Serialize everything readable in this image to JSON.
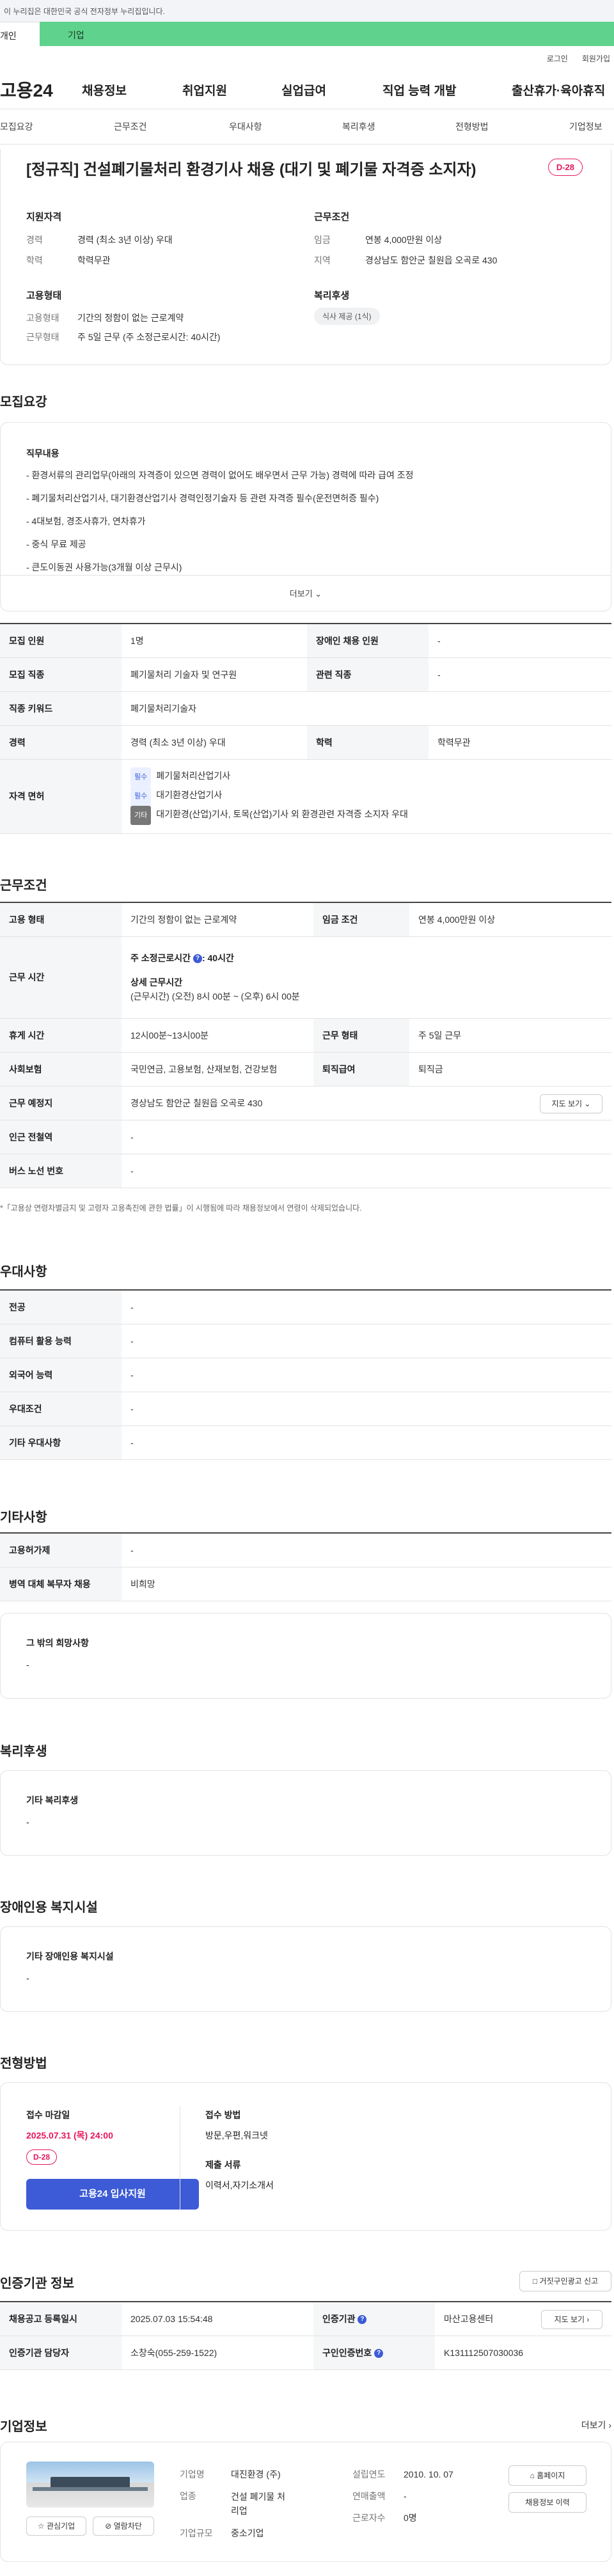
{
  "topbar": {
    "notice": "이 누리집은 대한민국 공식 전자정부 누리집입니다."
  },
  "tabs": {
    "individual": "개인",
    "company": "기업"
  },
  "utility": {
    "login": "로그인",
    "join": "회원가입"
  },
  "gnb": {
    "logo": "고용24",
    "items": [
      "채용정보",
      "취업지원",
      "실업급여",
      "직업 능력 개발",
      "출산휴가·육아휴직"
    ]
  },
  "anchors": [
    "모집요강",
    "근무조건",
    "우대사항",
    "복리후생",
    "전형방법",
    "기업정보"
  ],
  "job": {
    "title": "[정규직] 건설폐기물처리 환경기사 채용 (대기 및 폐기물 자격증 소지자)",
    "dday": "D-28",
    "qual_title": "지원자격",
    "career_k": "경력",
    "career_v": "경력 (최소 3년 이상) 우대",
    "edu_k": "학력",
    "edu_v": "학력무관",
    "emp_title": "고용형태",
    "emptype_k": "고용형태",
    "emptype_v": "기간의 정함이 없는 근로계약",
    "worktype_k": "근무형태",
    "worktype_v": "주 5일 근무 (주 소정근로시간: 40시간)",
    "cond_title": "근무조건",
    "wage_k": "임금",
    "wage_v": "연봉 4,000만원 이상",
    "region_k": "지역",
    "region_v": "경상남도 함안군 칠원읍 오곡로 430",
    "welfare_title": "복리후생",
    "welfare_pill": "식사 제공 (1식)"
  },
  "recruit": {
    "heading": "모집요강",
    "duty_title": "직무내용",
    "duties": [
      "- 환경서류의 관리업무(아래의 자격증이 있으면 경력이 없어도 배우면서 근무 가능) 경력에 따라 급여 조정",
      "- 폐기물처리산업기사, 대기환경산업기사 경력인정기술자 등 관련 자격증 필수(운전면허증 필수)",
      "- 4대보험, 경조사휴가, 연차휴가",
      "- 중식 무료 제공",
      "- 큰도이동권 사용가능(3개월 이상 근무시)"
    ],
    "more": "더보기",
    "table": {
      "count_k": "모집 인원",
      "count_v": "1명",
      "disabled_k": "장애인 채용 인원",
      "disabled_v": "-",
      "job_k": "모집 직종",
      "job_v": "폐기물처리 기술자 및 연구원",
      "related_k": "관련 직종",
      "related_v": "-",
      "keyword_k": "직종 키워드",
      "keyword_v": "폐기물처리기술자",
      "career_k": "경력",
      "career_v": "경력 (최소 3년 이상) 우대",
      "edu_k": "학력",
      "edu_v": "학력무관",
      "license_k": "자격 면허",
      "licenses": [
        {
          "tag": "필수",
          "name": "폐기물처리산업기사"
        },
        {
          "tag": "필수",
          "name": "대기환경산업기사"
        },
        {
          "tag": "기타",
          "name": "대기환경(산업)기사, 토목(산업)기사 외 환경관련 자격증 소지자 우대"
        }
      ]
    }
  },
  "work": {
    "heading": "근무조건",
    "emptype_k": "고용 형태",
    "emptype_v": "기간의 정함이 없는 근로계약",
    "wage_k": "임금 조건",
    "wage_v": "연봉 4,000만원 이상",
    "hours_k": "근무 시간",
    "hours_weekly": "주 소정근로시간",
    "hours_weekly_v": ": 40시간",
    "hours_detail_t": "상세 근무시간",
    "hours_detail_v": "(근무시간) (오전) 8시 00분 ~ (오후) 6시 00분",
    "break_k": "휴게 시간",
    "break_v": "12시00분~13시00분",
    "form_k": "근무 형태",
    "form_v": "주 5일 근무",
    "insurance_k": "사회보험",
    "insurance_v": "국민연금, 고용보험, 산재보험, 건강보험",
    "severance_k": "퇴직급여",
    "severance_v": "퇴직금",
    "place_k": "근무 예정지",
    "place_v": "경상남도 함안군 칠원읍 오곡로 430",
    "map_btn": "지도 보기",
    "subway_k": "인근 전철역",
    "subway_v": "-",
    "bus_k": "버스 노선 번호",
    "bus_v": "-",
    "note": "*「고용상 연령차별금지 및 고령자 고용촉진에 관한 법률」이 시행됨에 따라 채용정보에서 연령이 삭제되었습니다."
  },
  "pref": {
    "heading": "우대사항",
    "rows": [
      {
        "k": "전공",
        "v": "-"
      },
      {
        "k": "컴퓨터 활용 능력",
        "v": "-"
      },
      {
        "k": "외국어 능력",
        "v": "-"
      },
      {
        "k": "우대조건",
        "v": "-"
      },
      {
        "k": "기타 우대사항",
        "v": "-"
      }
    ]
  },
  "etc": {
    "heading": "기타사항",
    "rows": [
      {
        "k": "고용허가제",
        "v": "-"
      },
      {
        "k": "병역 대체 복무자 채용",
        "v": "비희망"
      }
    ],
    "hope_t": "그 밖의 희망사항",
    "hope_v": "-"
  },
  "welfare": {
    "heading": "복리후생",
    "t": "기타 복리후생",
    "v": "-"
  },
  "disabled": {
    "heading": "장애인용 복지시설",
    "t": "기타 장애인용 복지시설",
    "v": "-"
  },
  "apply": {
    "heading": "전형방법",
    "deadline_t": "접수 마감일",
    "deadline_v": "2025.07.31 (목) 24:00",
    "dday": "D-28",
    "apply_btn": "고용24 입사지원",
    "method_t": "접수 방법",
    "method_v": "방문,우편,워크넷",
    "docs_t": "제출 서류",
    "docs_v": "이력서,자기소개서"
  },
  "cert": {
    "heading": "인증기관 정보",
    "report_btn": "거짓구인광고 신고",
    "reg_k": "채용공고 등록일시",
    "reg_v": "2025.07.03 15:54:48",
    "org_k": "인증기관",
    "org_v": "마산고용센터",
    "map_btn": "지도 보기",
    "staff_k": "인증기관 담당자",
    "staff_v": "소창숙(055-259-1522)",
    "no_k": "구인인증번호",
    "no_v": "K131112507030036"
  },
  "company": {
    "heading": "기업정보",
    "more": "더보기",
    "like_btn": "관심기업",
    "block_btn": "열람차단",
    "name_k": "기업명",
    "name_v": "대진환경 (주)",
    "industry_k": "업종",
    "industry_v": "건설 폐기물 처리업",
    "size_k": "기업규모",
    "size_v": "중소기업",
    "founded_k": "설립연도",
    "founded_v": "2010. 10. 07",
    "sales_k": "연매출액",
    "sales_v": "-",
    "staff_k": "근로자수",
    "staff_v": "0명",
    "homepage_btn": "홈페이지",
    "history_btn": "채용정보 이력"
  }
}
